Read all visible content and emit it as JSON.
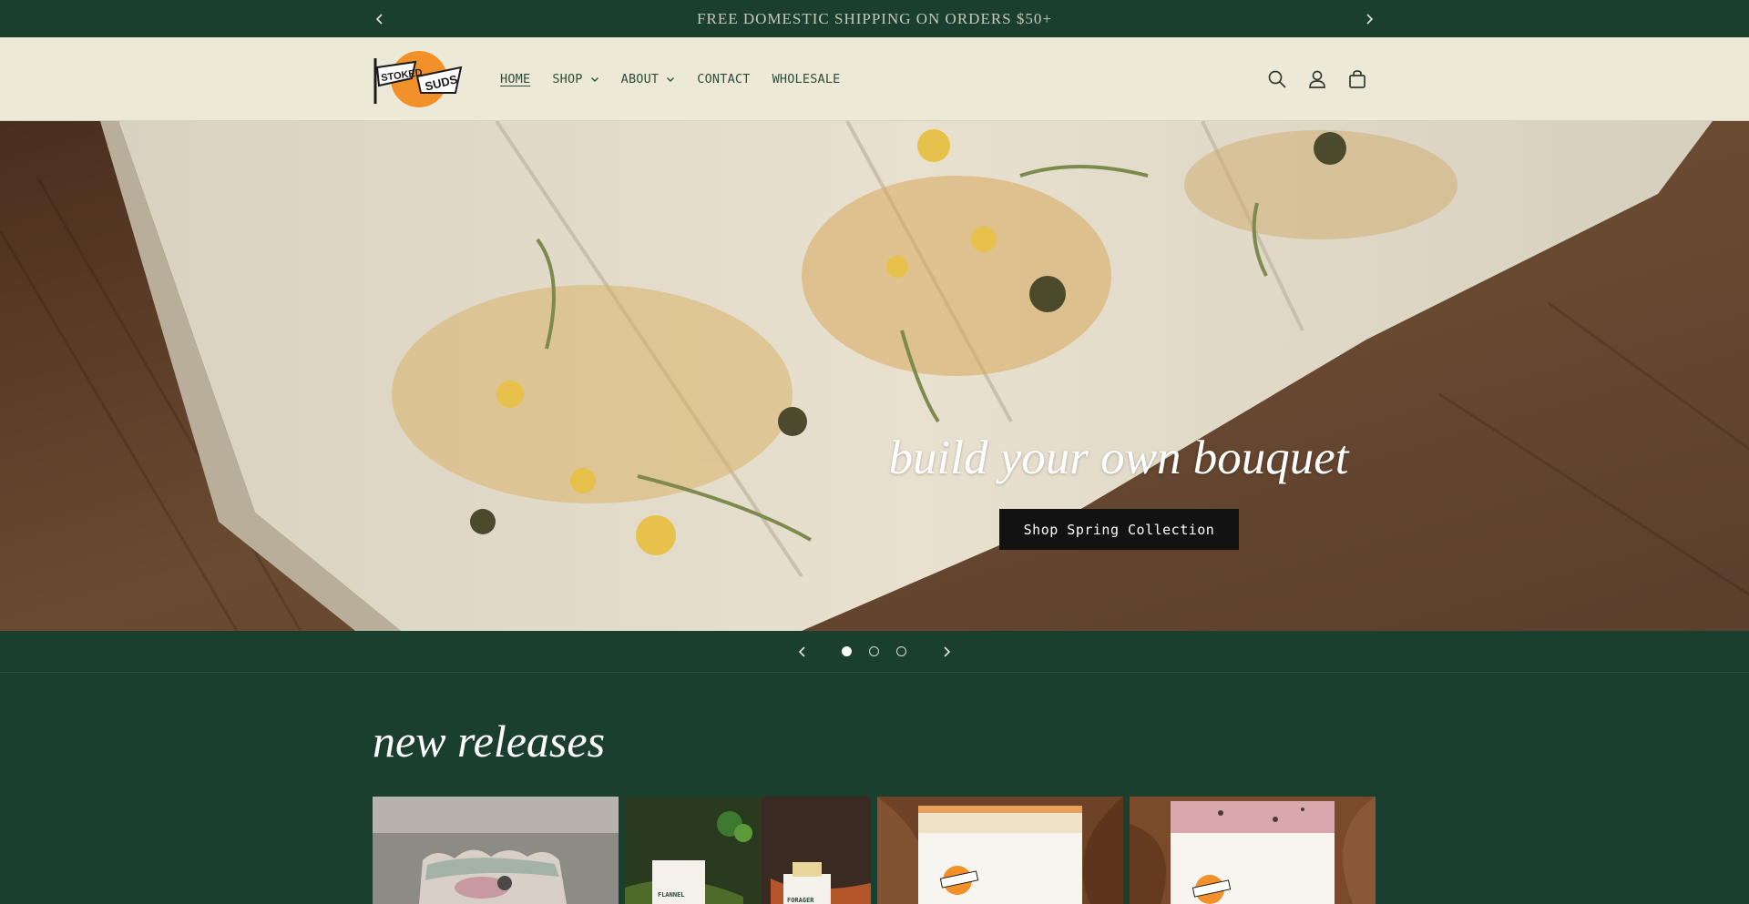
{
  "announcement": {
    "text": "FREE DOMESTIC SHIPPING ON ORDERS $50+",
    "prev_icon": "chevron-left-icon",
    "next_icon": "chevron-right-icon"
  },
  "header": {
    "logo_text_1": "STOKED",
    "logo_text_2": "SUDS",
    "nav": [
      {
        "label": "HOME",
        "active": true
      },
      {
        "label": "SHOP",
        "has_dropdown": true
      },
      {
        "label": "ABOUT",
        "has_dropdown": true
      },
      {
        "label": "CONTACT"
      },
      {
        "label": "WHOLESALE"
      }
    ],
    "icons": [
      "search-icon",
      "account-icon",
      "cart-icon"
    ]
  },
  "hero": {
    "title": "build your own bouquet",
    "button_label": "Shop Spring Collection"
  },
  "slider": {
    "slide_count": 3,
    "active_index": 0,
    "prev_icon": "chevron-left-icon",
    "next_icon": "chevron-right-icon"
  },
  "new_releases": {
    "title": "new releases",
    "products": [
      {
        "name": "product-1"
      },
      {
        "name": "product-2",
        "label_a": "FLANNEL",
        "label_b": "FORAGER"
      },
      {
        "name": "product-3"
      },
      {
        "name": "product-4"
      }
    ]
  },
  "colors": {
    "brand_green": "#1b3f2e",
    "header_cream": "#ecead6",
    "logo_orange": "#f2902a",
    "button_black": "#121212"
  }
}
